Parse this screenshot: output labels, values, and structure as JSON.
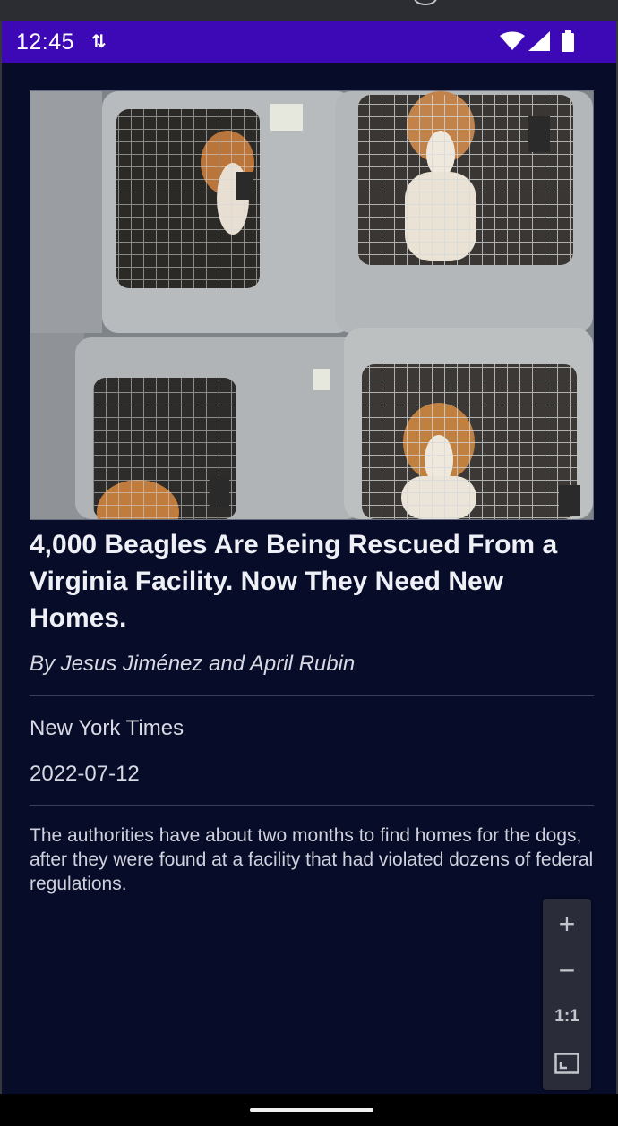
{
  "status_bar": {
    "time": "12:45",
    "sync_icon": "⇅",
    "wifi_icon": "wifi-icon",
    "signal_icon": "cell-signal-icon",
    "battery_icon": "battery-icon",
    "background_color": "#3d08b5"
  },
  "article": {
    "image_icon": "beagles-in-crates-photo",
    "headline": "4,000 Beagles Are Being Rescued From a Virginia Facility. Now They Need New Homes.",
    "byline": "By Jesus Jiménez and April Rubin",
    "source": "New York Times",
    "date": "2022-07-12",
    "summary": "The authorities have about two months to find homes for the dogs, after they were found at a facility that had violated dozens of federal regulations."
  },
  "zoom_controls": {
    "zoom_in_label": "+",
    "zoom_out_label": "−",
    "actual_size_label": "1:1",
    "fit_icon": "fit-screen-icon"
  },
  "colors": {
    "content_background": "#070c29",
    "text_primary": "#eef0f6",
    "text_secondary": "#d7d9e3",
    "divider": "#3a3f58"
  }
}
